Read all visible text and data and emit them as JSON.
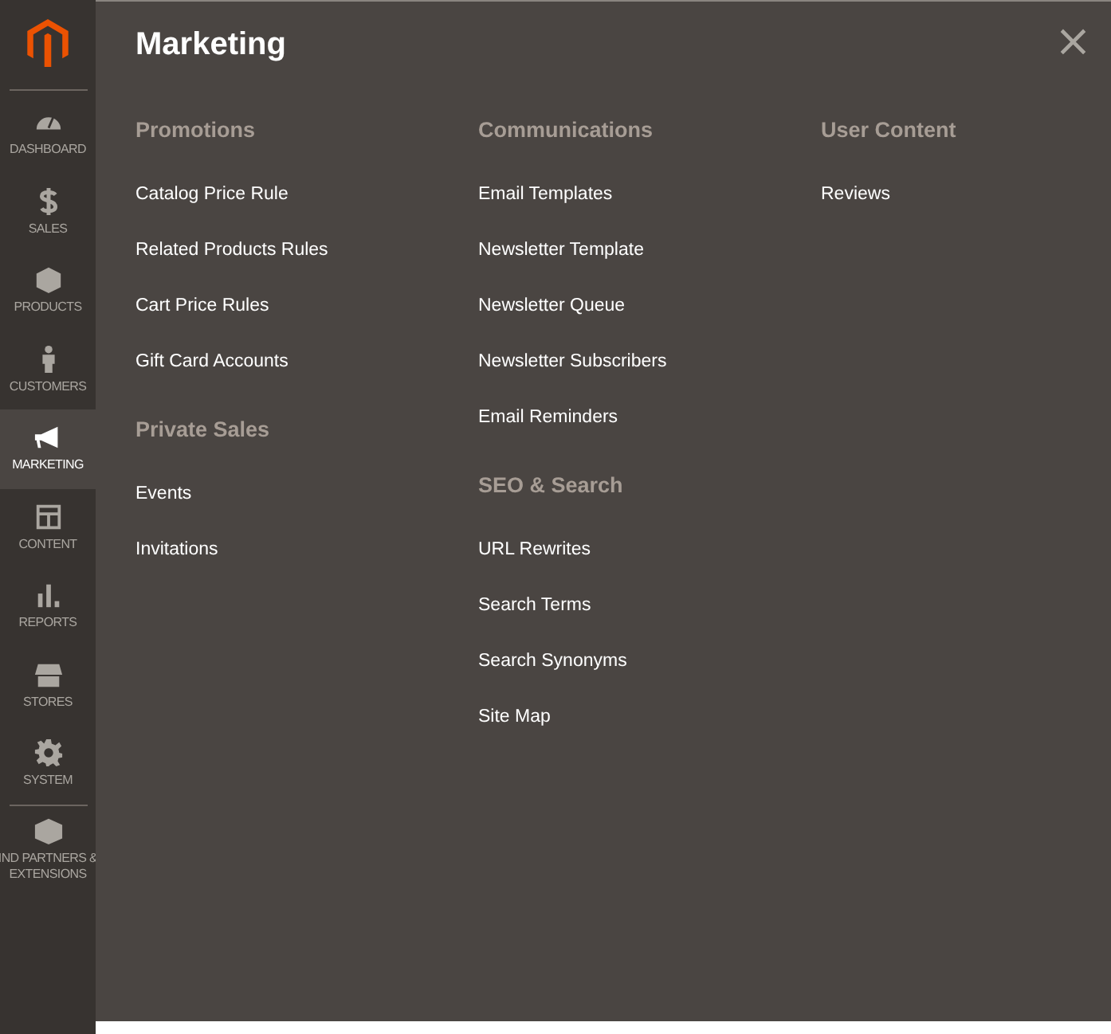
{
  "sidebar": {
    "items": [
      {
        "label": "DASHBOARD",
        "selected": false
      },
      {
        "label": "SALES",
        "selected": false
      },
      {
        "label": "PRODUCTS",
        "selected": false
      },
      {
        "label": "CUSTOMERS",
        "selected": false
      },
      {
        "label": "MARKETING",
        "selected": true
      },
      {
        "label": "CONTENT",
        "selected": false
      },
      {
        "label": "REPORTS",
        "selected": false
      },
      {
        "label": "STORES",
        "selected": false
      },
      {
        "label": "SYSTEM",
        "selected": false
      },
      {
        "label": "IND PARTNERS & EXTENSIONS",
        "selected": false
      }
    ]
  },
  "panel": {
    "title": "Marketing",
    "close": "×",
    "columns": [
      [
        {
          "heading": "Promotions",
          "links": [
            "Catalog Price Rule",
            "Related Products Rules",
            "Cart Price Rules",
            "Gift Card Accounts"
          ]
        },
        {
          "heading": "Private Sales",
          "links": [
            "Events",
            "Invitations"
          ]
        }
      ],
      [
        {
          "heading": "Communications",
          "links": [
            "Email Templates",
            "Newsletter Template",
            "Newsletter Queue",
            "Newsletter Subscribers",
            "Email Reminders"
          ]
        },
        {
          "heading": "SEO & Search",
          "links": [
            "URL Rewrites",
            "Search Terms",
            "Search Synonyms",
            "Site Map"
          ]
        }
      ],
      [
        {
          "heading": "User Content",
          "links": [
            "Reviews"
          ]
        }
      ]
    ]
  }
}
